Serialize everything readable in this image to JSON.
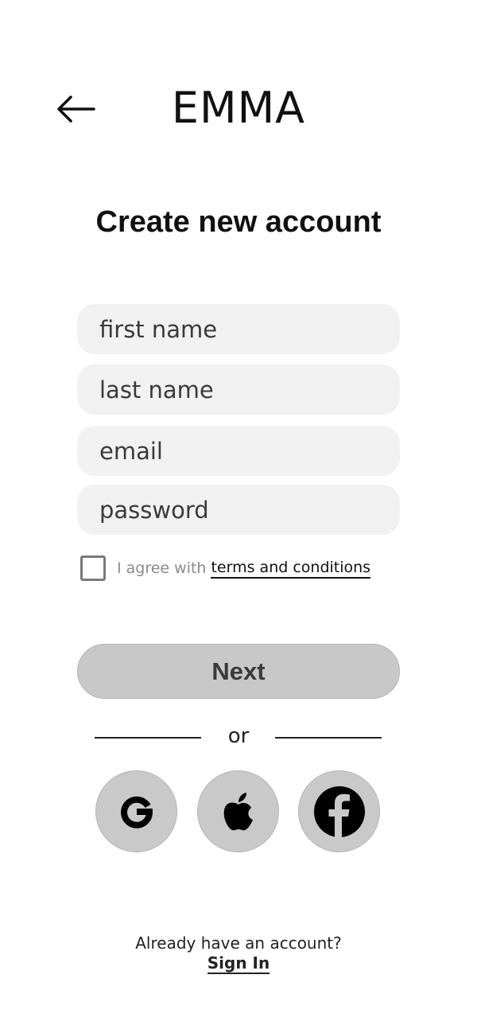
{
  "header": {
    "back_icon": "arrow-left-icon",
    "brand": "EMMA"
  },
  "title": "Create new account",
  "form": {
    "first_name": {
      "value": "",
      "placeholder": "first name"
    },
    "last_name": {
      "value": "",
      "placeholder": "last name"
    },
    "email": {
      "value": "",
      "placeholder": "email"
    },
    "password": {
      "value": "",
      "placeholder": "password"
    }
  },
  "agree": {
    "checked": false,
    "text": "I agree with",
    "link": "terms and conditions"
  },
  "next_label": "Next",
  "divider_text": "or",
  "social": [
    {
      "icon": "google-icon"
    },
    {
      "icon": "apple-icon"
    },
    {
      "icon": "facebook-icon"
    }
  ],
  "footer": {
    "prompt": "Already have an account?",
    "signin": "Sign In"
  },
  "colors": {
    "field_bg": "#f1f1f1",
    "button_bg": "#c8c8c8",
    "text": "#111111"
  }
}
